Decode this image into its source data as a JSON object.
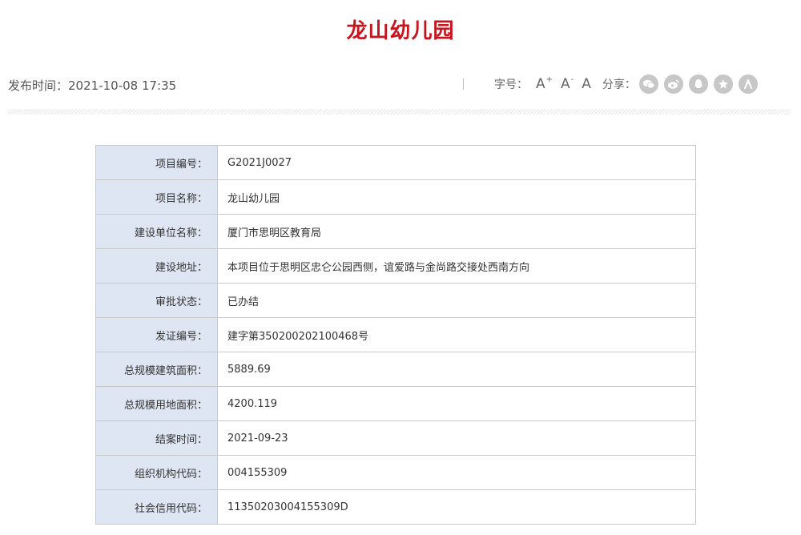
{
  "page": {
    "title": "龙山幼儿园"
  },
  "meta": {
    "publish_label": "发布时间：",
    "publish_time": "2021-10-08 17:35",
    "font_size_label": "字号：",
    "font_buttons": [
      {
        "letter": "A",
        "mark": "+"
      },
      {
        "letter": "A",
        "mark": "-"
      },
      {
        "letter": "A",
        "mark": ""
      }
    ],
    "share_label": "分享：",
    "share_icons": [
      "wechat-icon",
      "weibo-icon",
      "qq-icon",
      "qzone-icon",
      "renren-icon"
    ]
  },
  "table": {
    "separator": "：",
    "rows": [
      {
        "label": "项目编号",
        "value": "G2021J0027"
      },
      {
        "label": "项目名称",
        "value": "龙山幼儿园"
      },
      {
        "label": "建设单位名称",
        "value": "厦门市思明区教育局"
      },
      {
        "label": "建设地址",
        "value": "本项目位于思明区忠仑公园西侧，谊爱路与金尚路交接处西南方向"
      },
      {
        "label": "审批状态",
        "value": "已办结"
      },
      {
        "label": "发证编号",
        "value": "建字第350200202100468号"
      },
      {
        "label": "总规模建筑面积",
        "value": "5889.69"
      },
      {
        "label": "总规模用地面积",
        "value": "4200.119"
      },
      {
        "label": "结案时间",
        "value": "2021-09-23"
      },
      {
        "label": "组织机构代码",
        "value": "004155309"
      },
      {
        "label": "社会信用代码",
        "value": "11350203004155309D"
      }
    ]
  }
}
